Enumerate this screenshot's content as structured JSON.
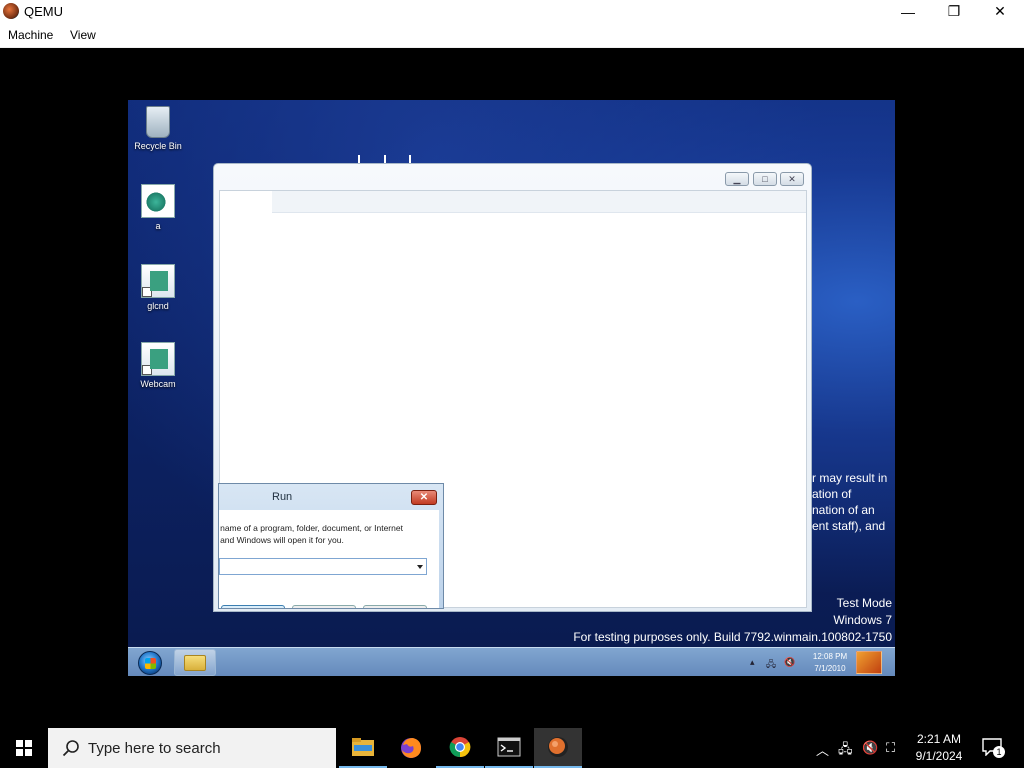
{
  "host_window": {
    "title": "QEMU",
    "menu": [
      "Machine",
      "View"
    ],
    "controls": {
      "minimize": "—",
      "restore": "❐",
      "close": "✕"
    }
  },
  "guest": {
    "desktop_icons": [
      {
        "label": "Recycle Bin",
        "icon": "recycle-bin-icon"
      },
      {
        "label": "a",
        "icon": "executable-icon"
      },
      {
        "label": "glcnd",
        "icon": "app-shortcut-icon"
      },
      {
        "label": "Webcam",
        "icon": "app-shortcut-icon"
      }
    ],
    "blank_window": {
      "controls": {
        "minimize": "▁",
        "maximize": "□",
        "close": "✕"
      }
    },
    "run_dialog": {
      "title": "Run",
      "close": "✕",
      "line1": "e name of a program, folder, document, or Internet",
      "line2": "t, and Windows will open it for you.",
      "input_value": ""
    },
    "partial_text": [
      "r may result in",
      "ation of",
      "nation of an",
      "ent staff), and"
    ],
    "watermark": {
      "line1": "Test Mode",
      "line2": "Windows 7",
      "line3": "For testing purposes only. Build 7792.winmain.100802-1750"
    },
    "taskbar": {
      "clock_time": "12:08 PM",
      "clock_date": "7/1/2010"
    }
  },
  "host_taskbar": {
    "search_placeholder": "Type here to search",
    "apps": [
      {
        "name": "file-explorer",
        "running": true
      },
      {
        "name": "firefox",
        "running": false
      },
      {
        "name": "chrome",
        "running": true
      },
      {
        "name": "terminal",
        "running": true
      },
      {
        "name": "qemu",
        "running": true,
        "active": true
      }
    ],
    "clock_time": "2:21 AM",
    "clock_date": "9/1/2024",
    "notification_count": "1"
  }
}
